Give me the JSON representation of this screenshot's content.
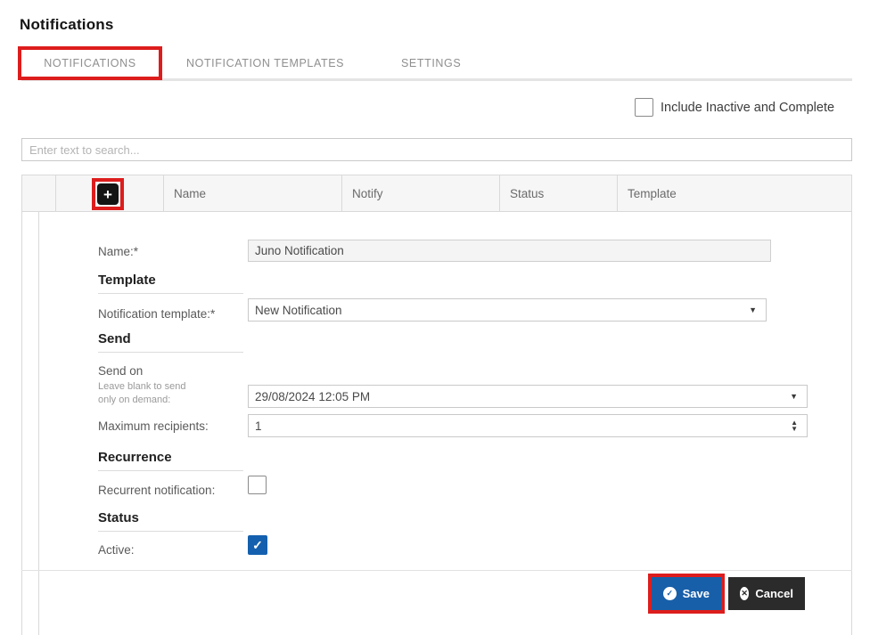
{
  "page": {
    "title": "Notifications"
  },
  "tabs": [
    {
      "label": "NOTIFICATIONS",
      "selected": true
    },
    {
      "label": "NOTIFICATION TEMPLATES",
      "selected": false
    },
    {
      "label": "SETTINGS",
      "selected": false
    }
  ],
  "filter": {
    "label": "Include Inactive and Complete",
    "checked": false
  },
  "search": {
    "placeholder": "Enter text to search..."
  },
  "grid": {
    "columns": [
      "Name",
      "Notify",
      "Status",
      "Template"
    ],
    "add_button_icon": "+"
  },
  "form": {
    "name": {
      "label": "Name:*",
      "value": "Juno Notification"
    },
    "template_section": "Template",
    "notification_template": {
      "label": "Notification template:*",
      "value": "New Notification"
    },
    "send_section": "Send",
    "send_on": {
      "label": "Send on",
      "hint_line1": "Leave blank to send",
      "hint_line2": "only on demand:",
      "value": "29/08/2024 12:05 PM"
    },
    "max_recipients": {
      "label": "Maximum recipients:",
      "value": "1"
    },
    "recurrence_section": "Recurrence",
    "recurrent": {
      "label": "Recurrent notification:",
      "checked": false
    },
    "status_section": "Status",
    "active": {
      "label": "Active:",
      "checked": true
    }
  },
  "buttons": {
    "save": "Save",
    "cancel": "Cancel"
  },
  "icons": {
    "check": "✓",
    "cross": "✕",
    "plus": "+",
    "caret_down": "▼",
    "spin_up": "▲",
    "spin_down": "▼"
  },
  "colors": {
    "highlight_red": "#dd1d1d",
    "primary_blue": "#185fa9",
    "dark": "#2b2b2b",
    "checkbox_blue": "#1460ae"
  }
}
